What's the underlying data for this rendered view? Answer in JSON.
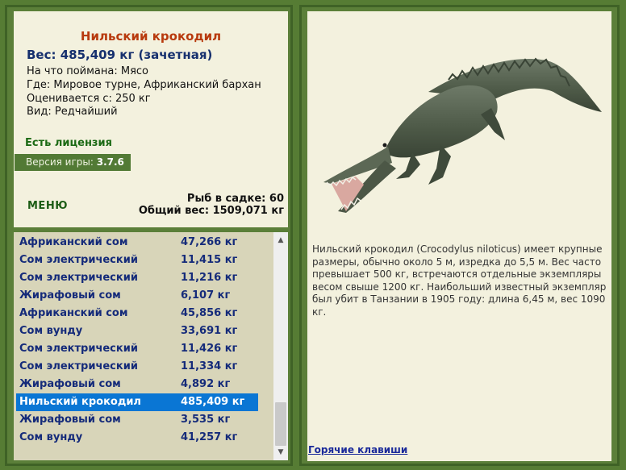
{
  "fish": {
    "name": "Нильский крокодил",
    "weight": "Вес: 485,409 кг (зачетная)",
    "caught_on": "На что поймана: Мясо",
    "location": "Где: Мировое турне, Африканский бархан",
    "valued_from": "Оценивается с: 250 кг",
    "rarity": "Вид: Редчайший"
  },
  "license": "Есть лицензия",
  "version": {
    "label": "Версия игры:",
    "value": "3.7.6"
  },
  "menu_label": "МЕНЮ",
  "stats": {
    "fish_in_cage": "Рыб в садке: 60",
    "total_weight": "Общий вес: 1509,071 кг"
  },
  "catch_list": [
    {
      "name": "Африканский сом",
      "weight": "47,266 кг"
    },
    {
      "name": "Сом электрический",
      "weight": "11,415 кг"
    },
    {
      "name": "Сом электрический",
      "weight": "11,216 кг"
    },
    {
      "name": "Жирафовый сом",
      "weight": "6,107 кг"
    },
    {
      "name": "Африканский сом",
      "weight": "45,856 кг"
    },
    {
      "name": "Сом вунду",
      "weight": "33,691 кг"
    },
    {
      "name": "Сом электрический",
      "weight": "11,426 кг"
    },
    {
      "name": "Сом электрический",
      "weight": "11,334 кг"
    },
    {
      "name": "Жирафовый сом",
      "weight": "4,892 кг"
    },
    {
      "name": "Нильский крокодил",
      "weight": "485,409 кг",
      "selected": true
    },
    {
      "name": "Жирафовый сом",
      "weight": "3,535 кг"
    },
    {
      "name": "Сом вунду",
      "weight": "41,257 кг"
    }
  ],
  "description": "Нильский крокодил (Crocodylus niloticus) имеет крупные размеры, обычно около 5 м, изредка до 5,5 м. Вес часто превышает 500 кг, встречаются отдельные экземпляры весом свыше 1200 кг. Наибольший известный экземпляр был убит в Танзании в 1905 году: длина 6,45 м, вес 1090 кг.",
  "hotkeys_label": "Горячие клавиши",
  "colors": {
    "background": "#567c34",
    "panel": "#f3f1de",
    "list_bg": "#d8d5b9",
    "selected": "#0a76d4",
    "title": "#b83a0e",
    "list_text": "#152b7a"
  }
}
